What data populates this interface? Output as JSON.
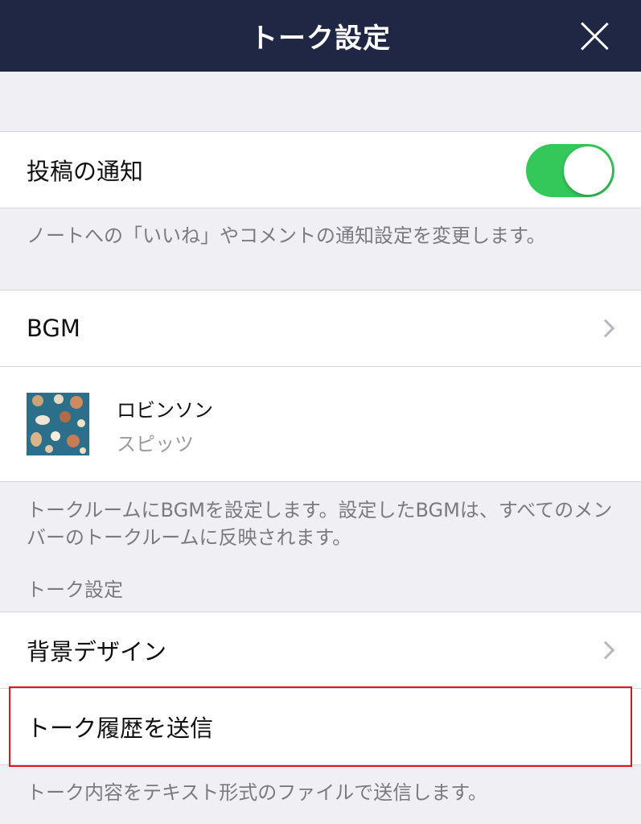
{
  "header": {
    "title": "トーク設定",
    "close_icon": "close-icon"
  },
  "post_notification": {
    "label": "投稿の通知",
    "toggle_on": true,
    "toggle_color": "#34c759",
    "note": "ノートへの「いいね」やコメントの通知設定を変更します。"
  },
  "bgm": {
    "label": "BGM",
    "track_title": "ロビンソン",
    "track_artist": "スピッツ",
    "note": "トークルームにBGMを設定します。設定したBGMは、すべてのメンバーのトークルームに反映されます。"
  },
  "talk_section": {
    "header": "トーク設定",
    "background_design_label": "背景デザイン",
    "send_history_label": "トーク履歴を送信",
    "send_history_note": "トーク内容をテキスト形式のファイルで送信します。"
  },
  "colors": {
    "header_bg": "#1f2744",
    "highlight_border": "#e0161f"
  }
}
